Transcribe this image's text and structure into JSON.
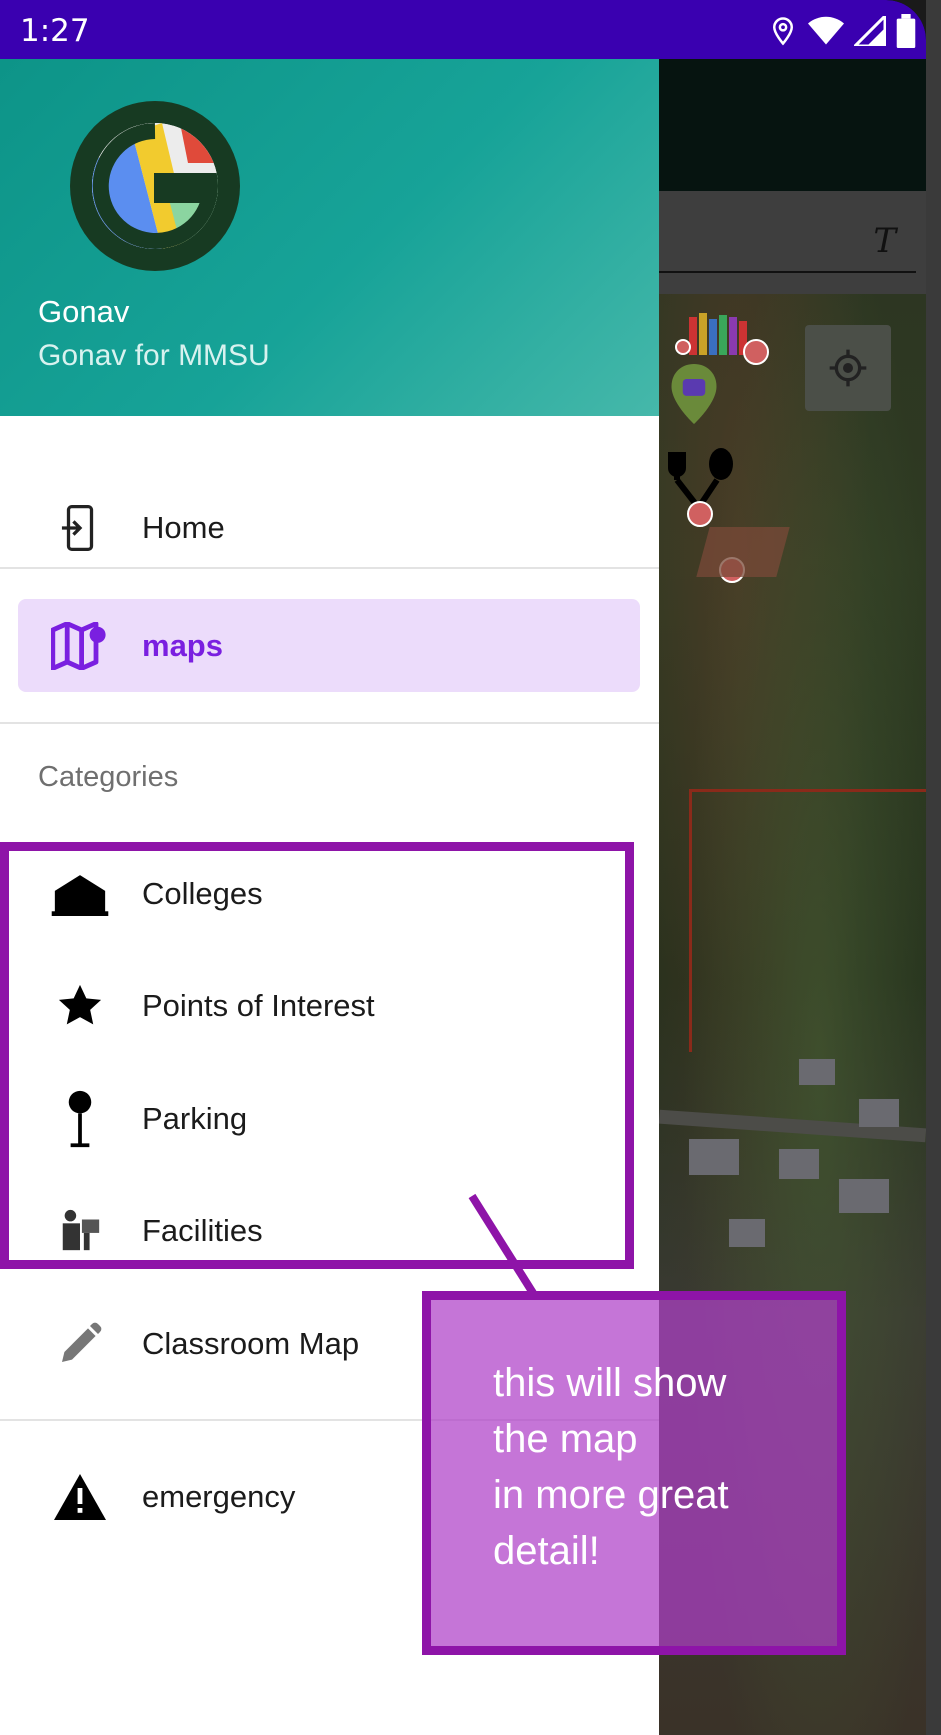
{
  "status_bar": {
    "time": "1:27"
  },
  "header": {
    "app_name": "Gonav",
    "subtitle": "Gonav for MMSU"
  },
  "menu": {
    "home": "Home",
    "maps": "maps",
    "categories_title": "Categories",
    "colleges": "Colleges",
    "points_of_interest": "Points of Interest",
    "parking": "Parking",
    "facilities": "Facilities",
    "classroom_map": "Classroom Map",
    "emergency": "emergency"
  },
  "annotation": {
    "callout_text": "this will show\nthe map\nin more great\ndetail!"
  },
  "colors": {
    "status_bar": "#3a00b0",
    "header_teal": "#0d9488",
    "selected_bg": "#ecdcfb",
    "selected_text": "#7a1fe0",
    "annotation": "#8e14a8"
  }
}
